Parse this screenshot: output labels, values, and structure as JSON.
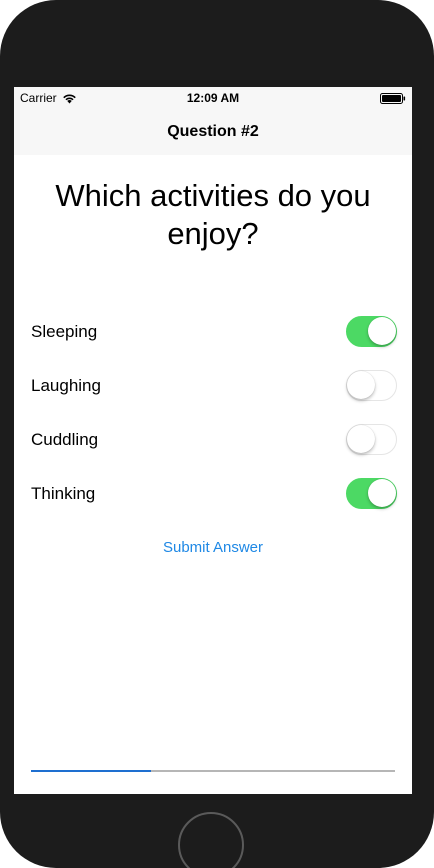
{
  "status_bar": {
    "carrier": "Carrier",
    "time": "12:09 AM",
    "wifi_icon": "wifi-icon",
    "battery_icon": "battery-icon"
  },
  "nav": {
    "title": "Question #2"
  },
  "question": {
    "text": "Which activities do you enjoy?"
  },
  "options": [
    {
      "label": "Sleeping",
      "on": true
    },
    {
      "label": "Laughing",
      "on": false
    },
    {
      "label": "Cuddling",
      "on": false
    },
    {
      "label": "Thinking",
      "on": true
    }
  ],
  "submit_label": "Submit Answer",
  "progress": {
    "fraction": 0.33
  },
  "colors": {
    "accent": "#1e88e5",
    "switch_on": "#4cd964",
    "progress_fill": "#1e6fd0"
  }
}
